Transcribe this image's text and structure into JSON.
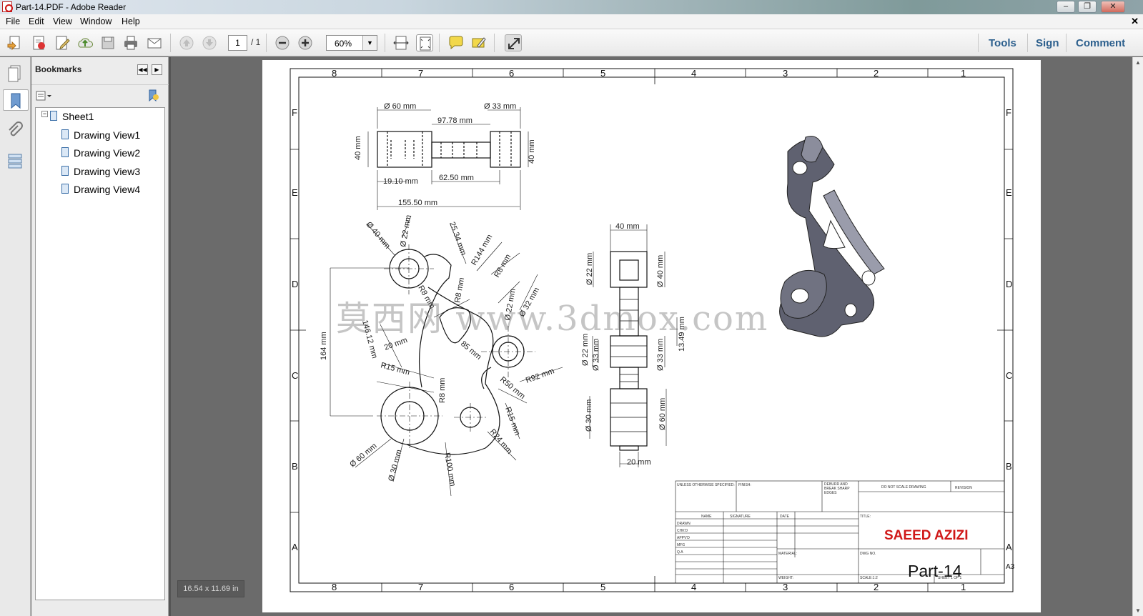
{
  "window": {
    "title": "Part-14.PDF - Adobe Reader",
    "controls": [
      "–",
      "❐",
      "✕"
    ]
  },
  "menu": [
    "File",
    "Edit",
    "View",
    "Window",
    "Help"
  ],
  "doc_close": "✕",
  "toolbar": {
    "page_current": "1",
    "page_total": "/ 1",
    "zoom": "60%",
    "links": [
      "Tools",
      "Sign",
      "Comment"
    ]
  },
  "bookmarks": {
    "title": "Bookmarks",
    "root": "Sheet1",
    "items": [
      "Drawing View1",
      "Drawing View2",
      "Drawing View3",
      "Drawing View4"
    ]
  },
  "page_size": "16.54 x 11.69 in",
  "drawing": {
    "zones_top": [
      "8",
      "7",
      "6",
      "5",
      "4",
      "3",
      "2",
      "1"
    ],
    "zones_side": [
      "F",
      "E",
      "D",
      "C",
      "B",
      "A"
    ],
    "title": "SAEED AZIZI",
    "part": "Part-14",
    "sheet_size": "A3",
    "watermark": "莫西网 www.3dmox.com",
    "dims_top": [
      "Ø 60 mm",
      "Ø 33 mm",
      "97.78 mm",
      "40 mm",
      "40 mm",
      "19.10 mm",
      "62.50 mm",
      "155.50 mm"
    ],
    "dims_front": [
      "Ø 40 mm",
      "Ø 22 mm",
      "25.34 mm",
      "R144 mm",
      "R8 mm",
      "R8 mm",
      "R6 mm",
      "Ø 22 mm",
      "Ø 32 mm",
      "146.12 mm",
      "20 mm",
      "85 mm",
      "R15 mm",
      "164 mm",
      "R92 mm",
      "R50 mm",
      "R8 mm",
      "R15 mm",
      "Ø 60 mm",
      "Ø 30 mm",
      "R24 mm",
      "R100 mm"
    ],
    "dims_side": [
      "40 mm",
      "Ø 22 mm",
      "Ø 40 mm",
      "Ø 22 mm",
      "Ø 33 mm",
      "Ø 33 mm",
      "13.49 mm",
      "Ø 30 mm",
      "Ø 60 mm",
      "20 mm"
    ],
    "tb_small": [
      "UNLESS OTHERWISE SPECIFIED:",
      "FINISH:",
      "DEBURR AND BREAK SHARP EDGES",
      "DO NOT SCALE DRAWING",
      "REVISION",
      "NAME",
      "SIGNATURE",
      "DATE",
      "TITLE:",
      "DRAWN",
      "CHK'D",
      "APPV'D",
      "MFG",
      "Q.A",
      "MATERIAL:",
      "DWG NO.",
      "WEIGHT:",
      "SCALE:1:2",
      "SHEET 1 OF 1"
    ]
  }
}
